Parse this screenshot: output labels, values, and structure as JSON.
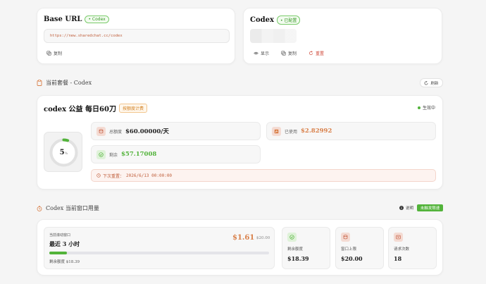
{
  "base_url": {
    "title": "Base URL",
    "tag": "• Codex",
    "url": "https://new.sharedchat.cc/codex",
    "copy_label": "复制"
  },
  "codex_key": {
    "title": "Codex",
    "tag": "• 已配置",
    "show_label": "显示",
    "copy_label": "复制",
    "reset_label": "重置"
  },
  "plan_section": {
    "heading": "当前套餐 - Codex",
    "refresh_label": "刷新"
  },
  "plan": {
    "name": "codex 公益 每日60刀",
    "billing_tag": "按额度计费",
    "status": "生效中",
    "percent": "5",
    "percent_unit": "%",
    "progress_fraction": 0.05,
    "total_label": "总额度",
    "total_value": "$60.00000/天",
    "used_label": "已使用",
    "used_value": "$2.82992",
    "remaining_label": "剩余",
    "remaining_value": "$57.17008",
    "reset_label": "下次重置：",
    "reset_time": "2026/6/13 00:00:00"
  },
  "usage_section": {
    "heading": "Codex 当前窗口用量",
    "help_label": "说明",
    "badge": "未触发限速"
  },
  "window": {
    "label": "当前滚动窗口",
    "value": "最近 3 小时",
    "amount": "$1.61",
    "limit": "$20.00",
    "progress_fraction": 0.08,
    "remaining_caption": "剩余额度 $18.39"
  },
  "mini_stats": [
    {
      "label": "剩余额度",
      "value": "$18.39"
    },
    {
      "label": "窗口上限",
      "value": "$20.00"
    },
    {
      "label": "请求次数",
      "value": "18"
    }
  ],
  "colors": {
    "green": "#52b33a",
    "orange": "#d9804a",
    "red": "#d04a3a"
  }
}
